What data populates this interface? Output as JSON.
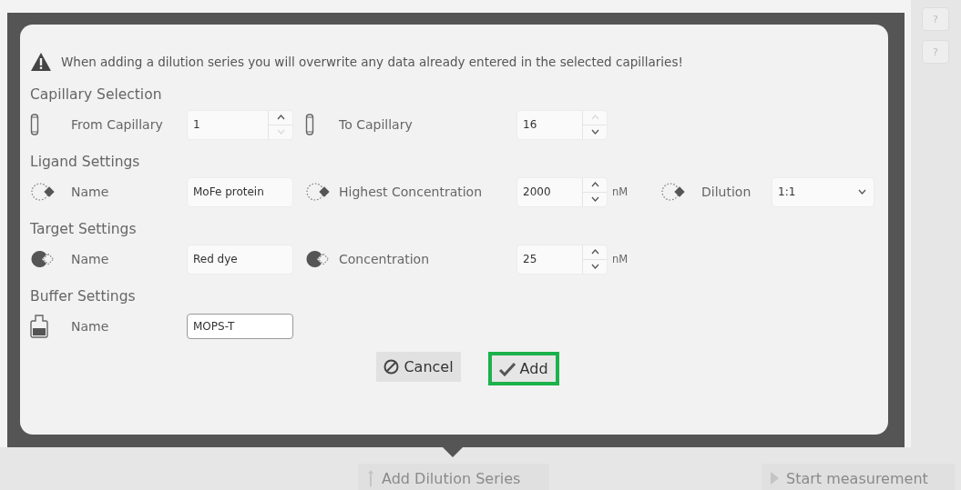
{
  "dialog": {
    "warning": "When adding a dilution series you will overwrite any data already entered in the selected capillaries!",
    "sections": [
      {
        "title": "Capillary Selection",
        "fields": [
          {
            "kind": "spin",
            "label": "From Capillary",
            "value": "1",
            "up_disabled": false,
            "down_disabled": true
          },
          {
            "kind": "spin",
            "label": "To Capillary",
            "value": "16",
            "up_disabled": true,
            "down_disabled": false
          }
        ]
      },
      {
        "title": "Ligand Settings",
        "fields": [
          {
            "kind": "text",
            "label": "Name",
            "value": "MoFe protein",
            "focused": false
          },
          {
            "kind": "spin",
            "label": "Highest Concentration",
            "value": "2000",
            "unit": "nM",
            "up_disabled": false,
            "down_disabled": false
          },
          {
            "kind": "select",
            "label": "Dilution",
            "value": "1:1"
          }
        ]
      },
      {
        "title": "Target Settings",
        "fields": [
          {
            "kind": "text",
            "label": "Name",
            "value": "Red dye",
            "focused": false
          },
          {
            "kind": "spin",
            "label": "Concentration",
            "value": "25",
            "unit": "nM",
            "up_disabled": false,
            "down_disabled": false
          }
        ]
      },
      {
        "title": "Buffer Settings",
        "fields": [
          {
            "kind": "text",
            "label": "Name",
            "value": "MOPS-T",
            "focused": true
          }
        ]
      }
    ],
    "buttons": [
      {
        "kind": "cancel",
        "label": "Cancel",
        "highlighted": false
      },
      {
        "kind": "add",
        "label": "Add",
        "highlighted": true
      }
    ]
  },
  "side_buttons": [
    "?",
    "?"
  ],
  "bottom_buttons": [
    {
      "kind": "add",
      "label": "Add Dilution Series",
      "disabled": true
    },
    {
      "kind": "start",
      "label": "Start measurement",
      "disabled": true
    }
  ]
}
